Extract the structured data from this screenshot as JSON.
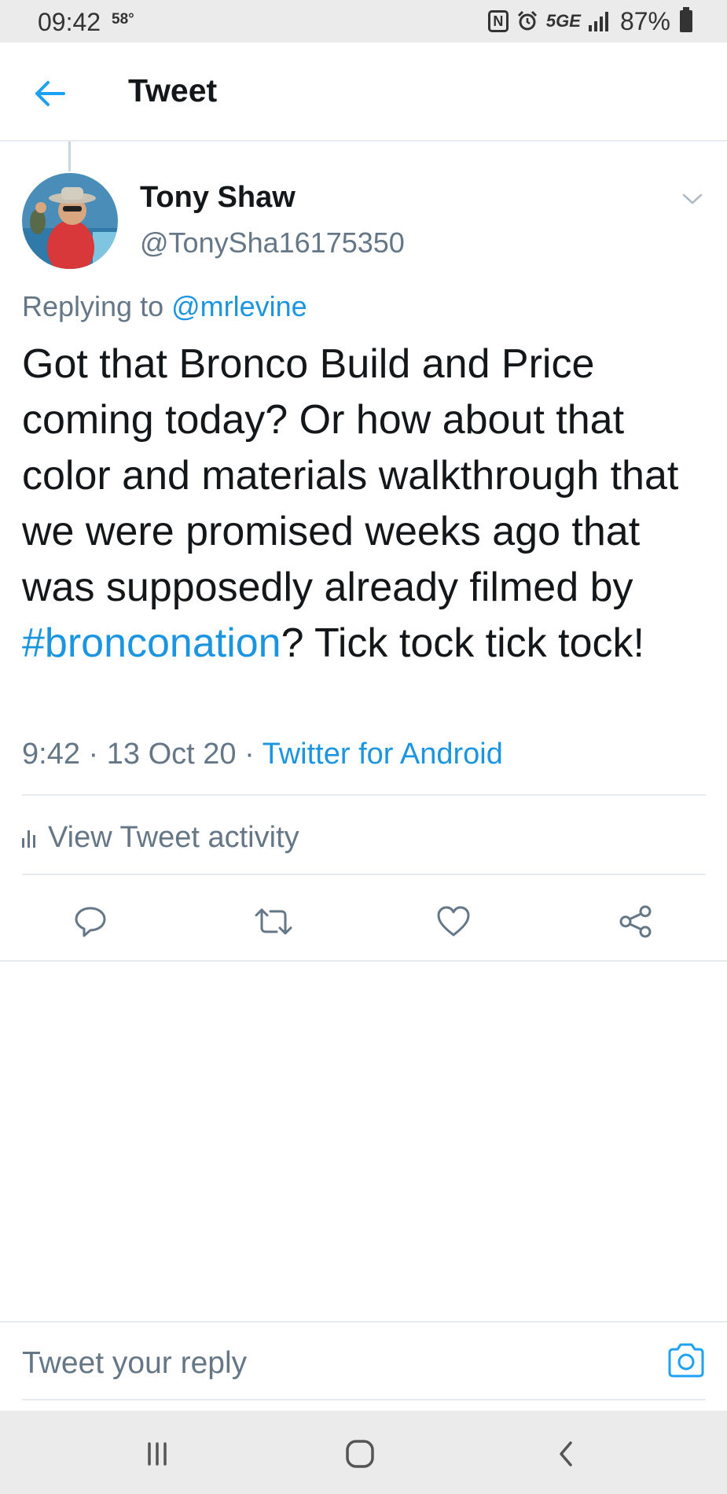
{
  "status_bar": {
    "time": "09:42",
    "temperature": "58°",
    "nfc": "N",
    "network": "5GE",
    "battery": "87%"
  },
  "header": {
    "title": "Tweet"
  },
  "tweet": {
    "author_name": "Tony Shaw",
    "author_handle": "@TonySha16175350",
    "replying_prefix": "Replying to ",
    "replying_to": "@mrlevine",
    "text_before": "Got that Bronco Build and Price coming today? Or how about that color and materials walkthrough that we were promised weeks ago that was supposedly already filmed by ",
    "hashtag": "#bronconation",
    "text_after": "? Tick tock tick tock!",
    "time": "9:42",
    "separator": " · ",
    "date": "13 Oct 20",
    "source": "Twitter for Android"
  },
  "activity": {
    "label": "View Tweet activity"
  },
  "actions": [
    {
      "icon": "reply-icon"
    },
    {
      "icon": "retweet-icon"
    },
    {
      "icon": "like-icon"
    },
    {
      "icon": "share-icon"
    }
  ],
  "reply": {
    "placeholder": "Tweet your reply"
  },
  "colors": {
    "link": "#1b95e0",
    "secondary_text": "#657786",
    "divider": "#e6ecf0",
    "status_bar_bg": "#ebebeb"
  }
}
